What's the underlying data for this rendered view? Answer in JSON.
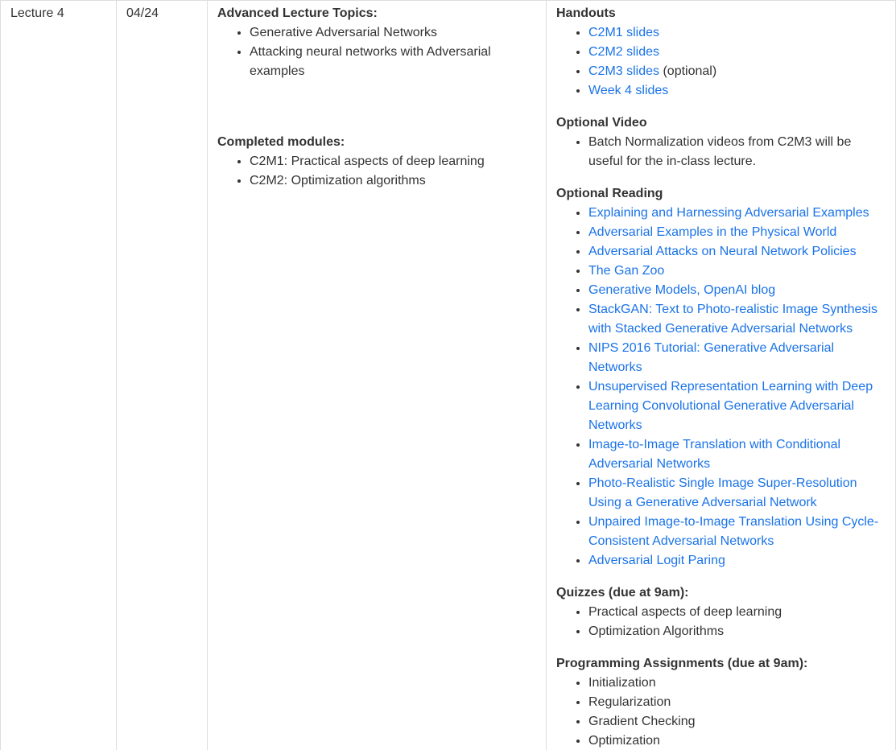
{
  "row": {
    "event": "Lecture 4",
    "date": "04/24"
  },
  "description": {
    "topics_heading": "Advanced Lecture Topics:",
    "topics": [
      "Generative Adversarial Networks",
      "Attacking neural networks with Adversarial examples"
    ],
    "modules_heading": "Completed modules:",
    "modules": [
      "C2M1: Practical aspects of deep learning",
      "C2M2: Optimization algorithms"
    ]
  },
  "materials": {
    "handouts_heading": "Handouts",
    "handouts": [
      {
        "label": "C2M1 slides",
        "suffix": ""
      },
      {
        "label": "C2M2 slides",
        "suffix": ""
      },
      {
        "label": "C2M3 slides",
        "suffix": " (optional)"
      },
      {
        "label": "Week 4 slides",
        "suffix": ""
      }
    ],
    "video_heading": "Optional Video",
    "video_items": [
      "Batch Normalization videos from C2M3 will be useful for the in-class lecture."
    ],
    "reading_heading": "Optional Reading",
    "readings": [
      "Explaining and Harnessing Adversarial Examples",
      "Adversarial Examples in the Physical World",
      "Adversarial Attacks on Neural Network Policies",
      "The Gan Zoo",
      "Generative Models, OpenAI blog",
      "StackGAN: Text to Photo-realistic Image Synthesis with Stacked Generative Adversarial Networks",
      "NIPS 2016 Tutorial: Generative Adversarial Networks",
      "Unsupervised Representation Learning with Deep Learning Convolutional Generative Adversarial Networks",
      "Image-to-Image Translation with Conditional Adversarial Networks",
      "Photo-Realistic Single Image Super-Resolution Using a Generative Adversarial Network",
      "Unpaired Image-to-Image Translation Using Cycle-Consistent Adversarial Networks",
      "Adversarial Logit Paring"
    ],
    "quizzes_heading": "Quizzes (due at 9am):",
    "quizzes": [
      "Practical aspects of deep learning",
      "Optimization Algorithms"
    ],
    "assignments_heading": "Programming Assignments (due at 9am):",
    "assignments": [
      "Initialization",
      "Regularization",
      "Gradient Checking",
      "Optimization"
    ]
  },
  "colors": {
    "link": "#1a73e8",
    "text": "#333333",
    "border": "#dddddd"
  }
}
